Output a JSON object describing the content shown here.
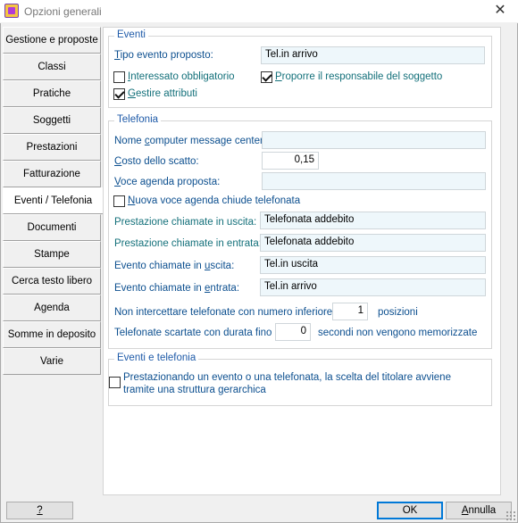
{
  "window": {
    "title": "Opzioni generali",
    "close_label": "✕"
  },
  "sidebar": {
    "items": [
      {
        "label": "Gestione e proposte"
      },
      {
        "label": "Classi"
      },
      {
        "label": "Pratiche"
      },
      {
        "label": "Soggetti"
      },
      {
        "label": "Prestazioni"
      },
      {
        "label": "Fatturazione"
      },
      {
        "label": "Eventi / Telefonia"
      },
      {
        "label": "Documenti"
      },
      {
        "label": "Stampe"
      },
      {
        "label": "Cerca testo libero"
      },
      {
        "label": "Agenda"
      },
      {
        "label": "Somme in deposito"
      },
      {
        "label": "Varie"
      }
    ],
    "active_index": 6
  },
  "eventi": {
    "title": "Eventi",
    "tipo_label_u": "T",
    "tipo_label_rest": "ipo evento proposto:",
    "tipo_value": "Tel.in arrivo",
    "interessato_u": "I",
    "interessato_rest": "nteressato obbligatorio",
    "interessato_checked": false,
    "proporre_u": "P",
    "proporre_rest": "roporre il responsabile del soggetto",
    "proporre_checked": true,
    "gestire_u": "G",
    "gestire_rest": "estire attributi",
    "gestire_checked": true
  },
  "telefonia": {
    "title": "Telefonia",
    "nome_pre": "Nome ",
    "nome_u": "c",
    "nome_post": "omputer message center:",
    "nome_value": "",
    "costo_u": "C",
    "costo_rest": "osto dello scatto:",
    "costo_value": "0,15",
    "voce_u": "V",
    "voce_rest": "oce agenda proposta:",
    "voce_value": "",
    "nuova_u": "N",
    "nuova_rest": "uova voce agenda chiude telefonata",
    "nuova_checked": false,
    "prest_uscita_label": "Prestazione chiamate in uscita:",
    "prest_uscita_value": "Telefonata addebito",
    "prest_entrata_label": "Prestazione chiamate in entrata:",
    "prest_entrata_value": "Telefonata addebito",
    "evento_uscita_pre": "Evento chiamate in ",
    "evento_uscita_u": "u",
    "evento_uscita_post": "scita:",
    "evento_uscita_value": "Tel.in uscita",
    "evento_entrata_pre": "Evento chiamate in ",
    "evento_entrata_u": "e",
    "evento_entrata_post": "ntrata:",
    "evento_entrata_value": "Tel.in arrivo",
    "non_intercettare_label": "Non intercettare telefonate con numero inferiore a",
    "non_intercettare_value": "1",
    "posizioni_label": "posizioni",
    "scartate_label": "Telefonate scartate con durata fino a",
    "scartate_value": "0",
    "secondi_label": "secondi non vengono memorizzate"
  },
  "eventi_telefonia": {
    "title": "Eventi e telefonia",
    "scelta_label_line1": "Prestazionando un evento o una telefonata, la scelta del titolare avviene",
    "scelta_label_line2": "tramite una struttura gerarchica",
    "scelta_checked": false
  },
  "footer": {
    "help_label": "?",
    "ok_label": "OK",
    "annulla_u": "A",
    "annulla_rest": "nnulla"
  }
}
